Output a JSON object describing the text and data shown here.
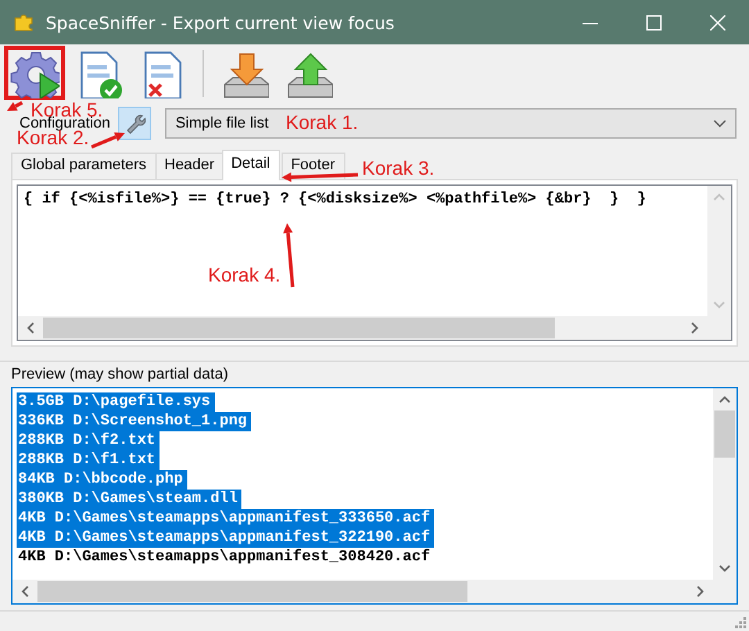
{
  "window": {
    "title": "SpaceSniffer - Export current view focus"
  },
  "toolbar": [
    {
      "kind": "run",
      "highlighted": true
    },
    {
      "kind": "accept",
      "highlighted": false
    },
    {
      "kind": "discard",
      "highlighted": false
    },
    {
      "kind": "import",
      "highlighted": false
    },
    {
      "kind": "export",
      "highlighted": false
    }
  ],
  "configuration": {
    "label": "Configuration",
    "value": "Simple file list"
  },
  "tabs": [
    {
      "label": "Global parameters",
      "selected": false
    },
    {
      "label": "Header",
      "selected": false
    },
    {
      "label": "Detail",
      "selected": true
    },
    {
      "label": "Footer",
      "selected": false
    }
  ],
  "template": {
    "text": "{ if {<%isfile%>} == {true} ? {<%disksize%> <%pathfile%> {&br}  }  }"
  },
  "preview": {
    "label": "Preview (may show partial data)",
    "rows": [
      {
        "text": "3.5GB D:\\pagefile.sys",
        "selected": true
      },
      {
        "text": "336KB D:\\Screenshot_1.png",
        "selected": true
      },
      {
        "text": "288KB D:\\f2.txt",
        "selected": true
      },
      {
        "text": "288KB D:\\f1.txt",
        "selected": true
      },
      {
        "text": "84KB D:\\bbcode.php",
        "selected": true
      },
      {
        "text": "380KB D:\\Games\\steam.dll",
        "selected": true
      },
      {
        "text": "4KB D:\\Games\\steamapps\\appmanifest_333650.acf",
        "selected": true
      },
      {
        "text": "4KB D:\\Games\\steamapps\\appmanifest_322190.acf",
        "selected": true
      },
      {
        "text": "4KB D:\\Games\\steamapps\\appmanifest_308420.acf",
        "selected": false
      }
    ]
  },
  "annotations": [
    {
      "text": "Korak 5."
    },
    {
      "text": "Korak 1."
    },
    {
      "text": "Korak 2."
    },
    {
      "text": "Korak 3."
    },
    {
      "text": "Korak 4."
    }
  ]
}
